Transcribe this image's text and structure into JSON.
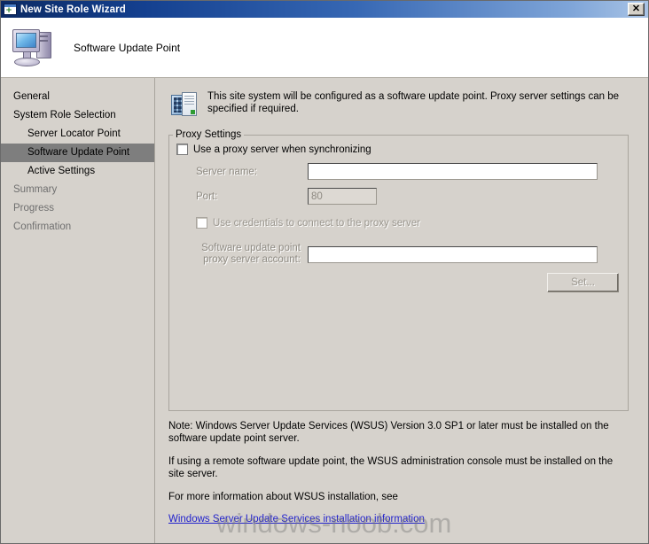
{
  "window": {
    "title": "New Site Role Wizard",
    "title_icon": "new-window-icon",
    "close_label": "✕"
  },
  "header": {
    "title": "Software Update Point",
    "icon": "computer-icon"
  },
  "sidebar": {
    "items": [
      {
        "label": "General",
        "state": "normal",
        "indent": false
      },
      {
        "label": "System Role Selection",
        "state": "normal",
        "indent": false
      },
      {
        "label": "Server Locator Point",
        "state": "normal",
        "indent": true
      },
      {
        "label": "Software Update Point",
        "state": "selected",
        "indent": true
      },
      {
        "label": "Active Settings",
        "state": "normal",
        "indent": true
      },
      {
        "label": "Summary",
        "state": "dim",
        "indent": false
      },
      {
        "label": "Progress",
        "state": "dim",
        "indent": false
      },
      {
        "label": "Confirmation",
        "state": "dim",
        "indent": false
      }
    ]
  },
  "main": {
    "info_icon": "site-system-icon",
    "info_text": "This site system will be configured as a software update point. Proxy server settings can be specified if required.",
    "group": {
      "legend": "Proxy Settings",
      "use_proxy_checkbox": {
        "label": "Use a proxy server when synchronizing",
        "checked": false,
        "enabled": true
      },
      "server_name": {
        "label": "Server name:",
        "value": "",
        "placeholder": "",
        "enabled": false
      },
      "port": {
        "label": "Port:",
        "value": "80",
        "enabled": false
      },
      "use_credentials_checkbox": {
        "label": "Use credentials to connect to the proxy server",
        "checked": false,
        "enabled": false
      },
      "proxy_account": {
        "label": "Software update point\nproxy server account:",
        "label_line1": "Software update point",
        "label_line2": "proxy server account:",
        "value": "",
        "enabled": false
      },
      "set_button": {
        "label": "Set...",
        "enabled": false
      }
    },
    "notes": {
      "note1": "Note: Windows Server Update Services (WSUS) Version 3.0 SP1 or later must be installed on the software update point server.",
      "note2": "If using a remote software update point, the WSUS administration console must be installed on the site server.",
      "note3": "For more information about WSUS installation, see",
      "link": "Windows Server Update Services installation information"
    }
  },
  "watermark": "windows-noob.com",
  "colors": {
    "titlebar_start": "#0b2a64",
    "titlebar_end": "#a9c4e6",
    "dialog_bg": "#d6d2cc",
    "selection_bg": "#7e7e7e",
    "link": "#2222cc",
    "disabled_text": "#8e8a82"
  }
}
